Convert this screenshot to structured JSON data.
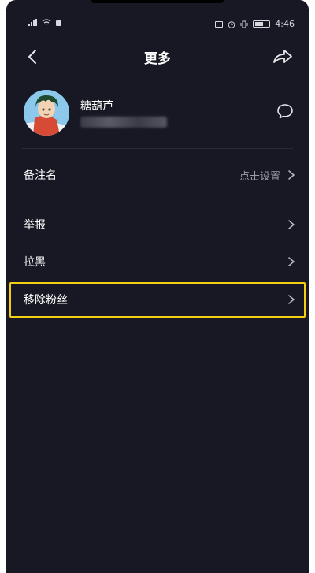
{
  "status_bar": {
    "left_indicator": "4G",
    "time": "4:46",
    "icons": [
      "signal-icon",
      "wifi-icon",
      "notification-icon",
      "nfc-icon",
      "alarm-icon",
      "vibrate-icon",
      "battery-icon"
    ]
  },
  "header": {
    "title": "更多",
    "back_icon": "back-arrow-icon",
    "share_icon": "share-icon"
  },
  "profile": {
    "name": "糖葫芦",
    "id_text": "",
    "message_icon": "chat-bubble-icon"
  },
  "menu": {
    "remark": {
      "label": "备注名",
      "value": "点击设置"
    },
    "report": {
      "label": "举报"
    },
    "block": {
      "label": "拉黑"
    },
    "remove_fan": {
      "label": "移除粉丝"
    }
  },
  "colors": {
    "background": "#171823",
    "highlight": "#f3cf13",
    "text": "#ffffff",
    "secondary_text": "#9c9da8"
  }
}
